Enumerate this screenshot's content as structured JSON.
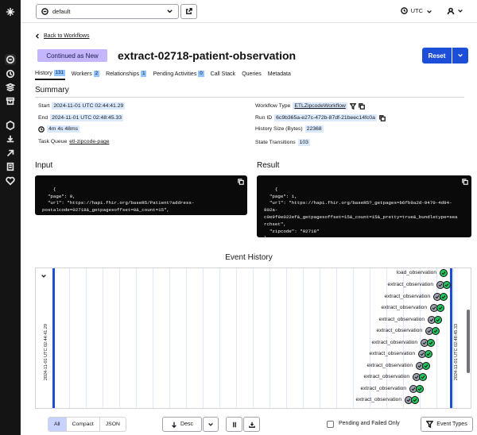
{
  "namespace": {
    "value": "default"
  },
  "timezone": {
    "value": "UTC"
  },
  "back_link": "Back to Workflows",
  "status": "Continued as New",
  "workflow_title": "extract-02718-patient-observation",
  "reset_label": "Reset",
  "tabs": [
    {
      "label": "History",
      "count": "131"
    },
    {
      "label": "Workers",
      "count": "2"
    },
    {
      "label": "Relationships",
      "count": "1"
    },
    {
      "label": "Pending Activities",
      "count": "0"
    },
    {
      "label": "Call Stack",
      "count": ""
    },
    {
      "label": "Queries",
      "count": ""
    },
    {
      "label": "Metadata",
      "count": ""
    }
  ],
  "summary": {
    "heading": "Summary",
    "start_label": "Start",
    "start_value": "2024-11-01 UTC 02:44:41.29",
    "end_label": "End",
    "end_value": "2024-11-01 UTC 02:48:45.33",
    "duration": "4m 4s 48ms",
    "task_queue_label": "Task Queue",
    "task_queue_value": "etl-zipcode-page",
    "workflow_type_label": "Workflow Type",
    "workflow_type_value": "ETLZipcodeWorkflow",
    "run_id_label": "Run ID",
    "run_id_value": "6c9b365a-e27c-472b-87df-21beec14fc0a",
    "history_size_label": "History Size (Bytes)",
    "history_size_value": "22368",
    "state_transitions_label": "State Transitions",
    "state_transitions_value": "103"
  },
  "input": {
    "heading": "Input",
    "code": "{\n  \"page\": 0,\n  \"url\": \"https://hapi.fhir.org/baseR5/Patient?address-\npostalcode=02718&_getpagesoffset=0&_count=15\",\n  \"zipcode\": \"02718\"\n}"
  },
  "result": {
    "heading": "Result",
    "code": "{\n  \"page\": 1,\n  \"url\": \"https://hapi.fhir.org/baseR5?_getpages=b6fb9a2d-9470-4d94-\n802a-\nc0e9f9e022ef&_getpagesoffset=15&_count=15&_pretty=true&_bundletype=sea\nrchset\",\n  \"zipcode\": \"02718\"\n}"
  },
  "event_history": {
    "heading": "Event History",
    "start_time": "2024-11-01 UTC 02:44:41.29",
    "end_time": "2024-11-01 UTC 02:48:45.33",
    "events": [
      {
        "label": "load_observation",
        "status": "completed"
      },
      {
        "label": "extract_observation",
        "status": "completed"
      },
      {
        "label": "extract_observation",
        "status": "completed"
      },
      {
        "label": "extract_observation",
        "status": "completed"
      },
      {
        "label": "extract_observation",
        "status": "completed"
      },
      {
        "label": "extract_observation",
        "status": "completed"
      },
      {
        "label": "extract_observation",
        "status": "completed"
      },
      {
        "label": "extract_observation",
        "status": "completed"
      },
      {
        "label": "extract_observation",
        "status": "completed"
      },
      {
        "label": "extract_observation",
        "status": "completed"
      },
      {
        "label": "extract_observation",
        "status": "completed"
      },
      {
        "label": "extract_observation",
        "status": "completed"
      }
    ]
  },
  "view_modes": [
    "All",
    "Compact",
    "JSON"
  ],
  "view_mode_selected": "All",
  "sort_label": "Desc",
  "pending_failed_label": "Pending and Failed Only",
  "event_types_label": "Event Types",
  "colors": {
    "accent": "#1d4ed8",
    "status_badge": "#c4b5fd",
    "count_badge": "#93c5fd",
    "event_dot": "#22c55e"
  }
}
